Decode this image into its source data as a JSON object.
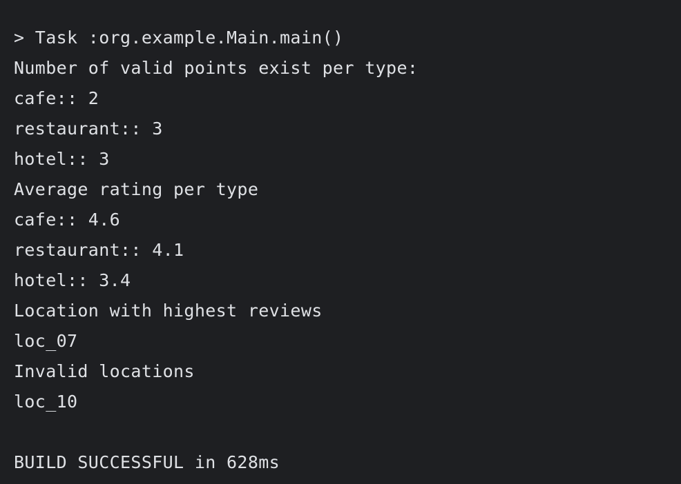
{
  "console": {
    "lines": [
      "> Task :org.example.Main.main()",
      "Number of valid points exist per type:",
      "cafe:: 2",
      "restaurant:: 3",
      "hotel:: 3",
      "Average rating per type",
      "cafe:: 4.6",
      "restaurant:: 4.1",
      "hotel:: 3.4",
      "Location with highest reviews",
      "loc_07",
      "Invalid locations",
      "loc_10",
      "",
      "BUILD SUCCESSFUL in 628ms"
    ]
  },
  "colors": {
    "background": "#1e1f22",
    "text": "#dfe1e5"
  }
}
